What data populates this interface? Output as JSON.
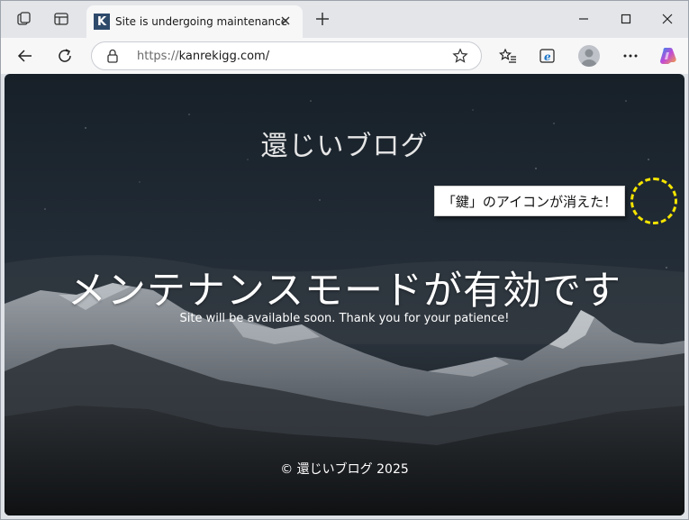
{
  "browser": {
    "tab": {
      "favicon_letter": "K",
      "title": "Site is undergoing maintenance"
    },
    "address_bar": {
      "url_protocol": "https://",
      "url_host": "kanrekigg.com/"
    },
    "icons": {
      "workspaces": "workspaces-icon",
      "tab_actions": "vertical-tabs-icon",
      "new_tab": "plus-icon",
      "minimize": "minimize-icon",
      "maximize": "maximize-icon",
      "close": "close-icon",
      "back": "back-arrow-icon",
      "refresh": "refresh-icon",
      "lock": "lock-icon",
      "favorite": "star-icon",
      "favorites": "favorites-icon",
      "ie_mode": "internet-explorer-icon",
      "profile": "profile-avatar",
      "more": "more-icon",
      "copilot": "copilot-icon"
    }
  },
  "page": {
    "site_title": "還じいブログ",
    "heading": "メンテナンスモードが有効です",
    "subtext": "Site will be available soon. Thank you for your patience!",
    "footer": "© 還じいブログ 2025"
  },
  "annotation": {
    "callout_text": "「鍵」のアイコンが消えた！",
    "ring_color": "#f5e400"
  }
}
